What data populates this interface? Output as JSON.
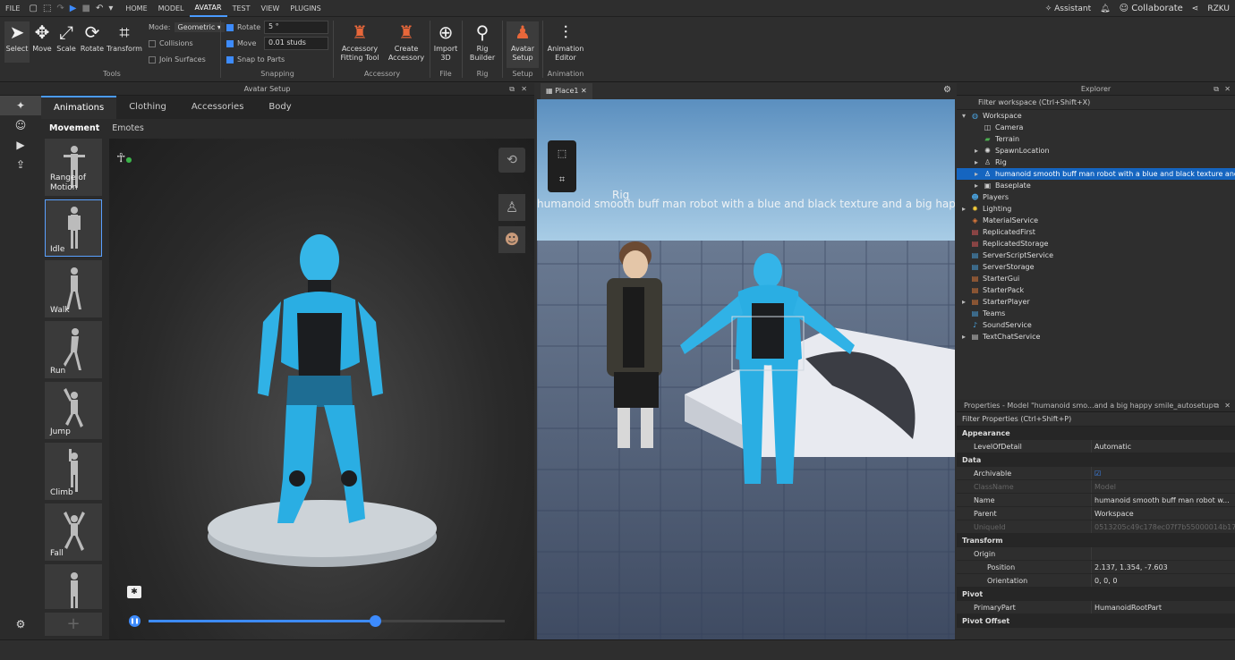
{
  "menu": {
    "file": "FILE",
    "tabs": [
      "HOME",
      "MODEL",
      "AVATAR",
      "TEST",
      "VIEW",
      "PLUGINS"
    ],
    "active": "AVATAR"
  },
  "topright": {
    "assistant": "Assistant",
    "collaborate": "Collaborate",
    "user": "RZKU"
  },
  "ribbon": {
    "tools": [
      {
        "label": "Select"
      },
      {
        "label": "Move"
      },
      {
        "label": "Scale"
      },
      {
        "label": "Rotate"
      },
      {
        "label": "Transform"
      }
    ],
    "mode_label": "Mode:",
    "mode_value": "Geometric",
    "collisions": "Collisions",
    "join_surfaces": "Join Surfaces",
    "rotate": "Rotate",
    "rotate_value": "5 °",
    "move": "Move",
    "move_value": "0.01 studs",
    "snap_to_parts": "Snap to Parts",
    "accessory_fitting": "Accessory Fitting Tool",
    "create_accessory": "Create Accessory",
    "import3d": "Import 3D",
    "rig_builder": "Rig Builder",
    "avatar_setup": "Avatar Setup",
    "animation_editor": "Animation Editor",
    "groups": {
      "tools": "Tools",
      "snapping": "Snapping",
      "accessory": "Accessory",
      "file": "File",
      "rig": "Rig",
      "setup": "Setup",
      "animation": "Animation"
    }
  },
  "avatar_setup": {
    "title": "Avatar Setup",
    "tabs": [
      "Animations",
      "Clothing",
      "Accessories",
      "Body"
    ],
    "subtabs": [
      "Movement",
      "Emotes"
    ],
    "animations": [
      "Range of Motion",
      "Idle",
      "Walk",
      "Run",
      "Jump",
      "Climb",
      "Fall"
    ],
    "playback_progress": 0.635
  },
  "viewport": {
    "tab": "Place1",
    "rig_label": "Rig",
    "model_caption": "humanoid smooth buff man robot with a blue and black texture and a big happy smile"
  },
  "explorer": {
    "title": "Explorer",
    "filter": "Filter workspace (Ctrl+Shift+X)",
    "items": [
      {
        "label": "Workspace",
        "indent": 0,
        "arrow": "▾",
        "icon": "◍",
        "color": "#4aa3e0"
      },
      {
        "label": "Camera",
        "indent": 1,
        "arrow": "",
        "icon": "◫",
        "color": "#ccc"
      },
      {
        "label": "Terrain",
        "indent": 1,
        "arrow": "",
        "icon": "▰",
        "color": "#4caf50"
      },
      {
        "label": "SpawnLocation",
        "indent": 1,
        "arrow": "▸",
        "icon": "✺",
        "color": "#ddd"
      },
      {
        "label": "Rig",
        "indent": 1,
        "arrow": "▸",
        "icon": "♙",
        "color": "#ccc"
      },
      {
        "label": "humanoid smooth buff man robot with a blue and black texture and a big happy smile_autosetup",
        "indent": 1,
        "arrow": "▸",
        "icon": "♙",
        "color": "#fff",
        "selected": true
      },
      {
        "label": "Baseplate",
        "indent": 1,
        "arrow": "▸",
        "icon": "▣",
        "color": "#ccc"
      },
      {
        "label": "Players",
        "indent": 0,
        "arrow": "",
        "icon": "☻",
        "color": "#4aa3e0"
      },
      {
        "label": "Lighting",
        "indent": 0,
        "arrow": "▸",
        "icon": "✹",
        "color": "#f0c93a"
      },
      {
        "label": "MaterialService",
        "indent": 0,
        "arrow": "",
        "icon": "◈",
        "color": "#e07a3a"
      },
      {
        "label": "ReplicatedFirst",
        "indent": 0,
        "arrow": "",
        "icon": "▤",
        "color": "#e05a5a"
      },
      {
        "label": "ReplicatedStorage",
        "indent": 0,
        "arrow": "",
        "icon": "▤",
        "color": "#e05a5a"
      },
      {
        "label": "ServerScriptService",
        "indent": 0,
        "arrow": "",
        "icon": "▤",
        "color": "#4aa3e0"
      },
      {
        "label": "ServerStorage",
        "indent": 0,
        "arrow": "",
        "icon": "▤",
        "color": "#4aa3e0"
      },
      {
        "label": "StarterGui",
        "indent": 0,
        "arrow": "",
        "icon": "▤",
        "color": "#e07a3a"
      },
      {
        "label": "StarterPack",
        "indent": 0,
        "arrow": "",
        "icon": "▤",
        "color": "#e07a3a"
      },
      {
        "label": "StarterPlayer",
        "indent": 0,
        "arrow": "▸",
        "icon": "▤",
        "color": "#e07a3a"
      },
      {
        "label": "Teams",
        "indent": 0,
        "arrow": "",
        "icon": "▤",
        "color": "#4aa3e0"
      },
      {
        "label": "SoundService",
        "indent": 0,
        "arrow": "",
        "icon": "♪",
        "color": "#4aa3e0"
      },
      {
        "label": "TextChatService",
        "indent": 0,
        "arrow": "▸",
        "icon": "▤",
        "color": "#ccc"
      }
    ]
  },
  "properties": {
    "title": "Properties - Model \"humanoid smo...and a big happy smile_autosetup\"",
    "filter": "Filter Properties (Ctrl+Shift+P)",
    "rows": [
      {
        "type": "section",
        "k": "Appearance",
        "v": ""
      },
      {
        "type": "row",
        "k": "LevelOfDetail",
        "v": "Automatic"
      },
      {
        "type": "section",
        "k": "Data",
        "v": ""
      },
      {
        "type": "row",
        "k": "Archivable",
        "v": "☑"
      },
      {
        "type": "dim",
        "k": "ClassName",
        "v": "Model"
      },
      {
        "type": "row",
        "k": "Name",
        "v": "humanoid smooth buff man robot w..."
      },
      {
        "type": "row",
        "k": "Parent",
        "v": "Workspace"
      },
      {
        "type": "dim",
        "k": "UniqueId",
        "v": "0513205c49c178ec07f7b55000014b17"
      },
      {
        "type": "section",
        "k": "Transform",
        "v": ""
      },
      {
        "type": "sub",
        "k": "Origin",
        "v": ""
      },
      {
        "type": "sub2",
        "k": "Position",
        "v": "2.137, 1.354, -7.603"
      },
      {
        "type": "sub2",
        "k": "Orientation",
        "v": "0, 0, 0"
      },
      {
        "type": "section",
        "k": "Pivot",
        "v": ""
      },
      {
        "type": "row",
        "k": "PrimaryPart",
        "v": "HumanoidRootPart"
      },
      {
        "type": "section",
        "k": "Pivot Offset",
        "v": ""
      }
    ]
  }
}
